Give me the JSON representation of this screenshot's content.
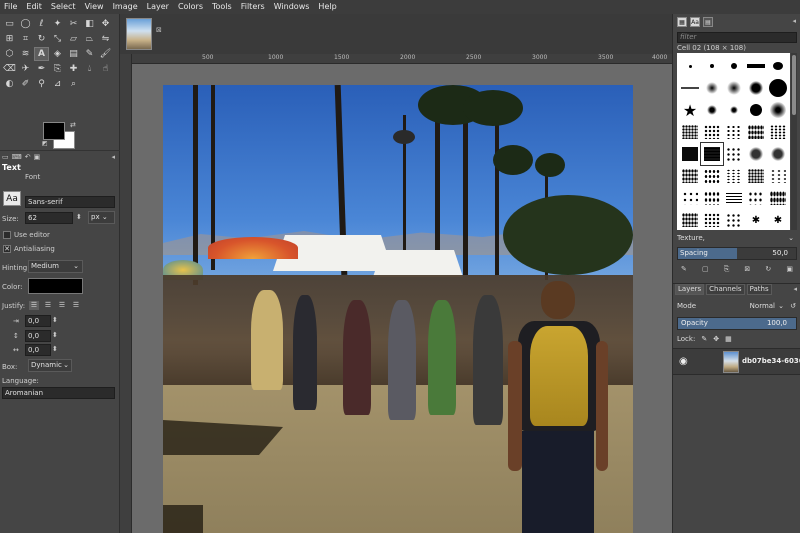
{
  "menubar": {
    "items": [
      "File",
      "Edit",
      "Select",
      "View",
      "Image",
      "Layer",
      "Colors",
      "Tools",
      "Filters",
      "Windows",
      "Help"
    ]
  },
  "toolbox": {
    "tools": [
      "rect-select-icon",
      "ellipse-select-icon",
      "lasso-icon",
      "fuzzy-select-icon",
      "scissors-icon",
      "foreground-select-icon",
      "move-icon",
      "align-icon",
      "crop-icon",
      "rotate-icon",
      "scale-icon",
      "shear-icon",
      "perspective-icon",
      "flip-icon",
      "cage-icon",
      "warp-icon",
      "text-tool-icon",
      "bucket-fill-icon",
      "gradient-icon",
      "pencil-icon",
      "paintbrush-icon",
      "eraser-icon",
      "airbrush-icon",
      "ink-icon",
      "clone-icon",
      "heal-icon",
      "blur-icon",
      "smudge-icon",
      "dodge-icon",
      "paths-icon",
      "color-picker-icon",
      "measure-icon",
      "zoom-icon"
    ]
  },
  "text_options": {
    "title": "Text",
    "font_label": "Font",
    "font_icon_text": "Aa",
    "font_value": "Sans-serif",
    "size_label": "Size:",
    "size_value": "62",
    "size_unit": "px",
    "use_editor_label": "Use editor",
    "antialiasing_label": "Antialiasing",
    "antialiasing_mark": "✕",
    "hinting_label": "Hinting:",
    "hinting_value": "Medium",
    "color_label": "Color:",
    "color_value": "#000000",
    "justify_label": "Justify:",
    "indent_value": "0,0",
    "line_spacing_value": "0,0",
    "letter_spacing_value": "0,0",
    "box_label": "Box:",
    "box_value": "Dynamic",
    "language_label": "Language:",
    "language_value": "Aromanian"
  },
  "rulers": {
    "h_labels": [
      "500",
      "1000",
      "1500",
      "2000",
      "2500",
      "3000",
      "3500",
      "4000"
    ]
  },
  "brushes": {
    "filter_placeholder": "filter",
    "info": "Cell 02 (108 × 108)",
    "texture_label": "Texture,",
    "spacing_label": "Spacing",
    "spacing_value": "50,0",
    "spacing_percent": 50
  },
  "layers": {
    "tabs": [
      "Layers",
      "Channels",
      "Paths"
    ],
    "mode_label": "Mode",
    "mode_value": "Normal",
    "opacity_label": "Opacity",
    "opacity_value": "100,0",
    "lock_label": "Lock:",
    "layer_name": "db07be34-6036"
  },
  "colors": {
    "accent": "#4c6a8c",
    "foreground": "#000000",
    "background": "#ffffff"
  }
}
